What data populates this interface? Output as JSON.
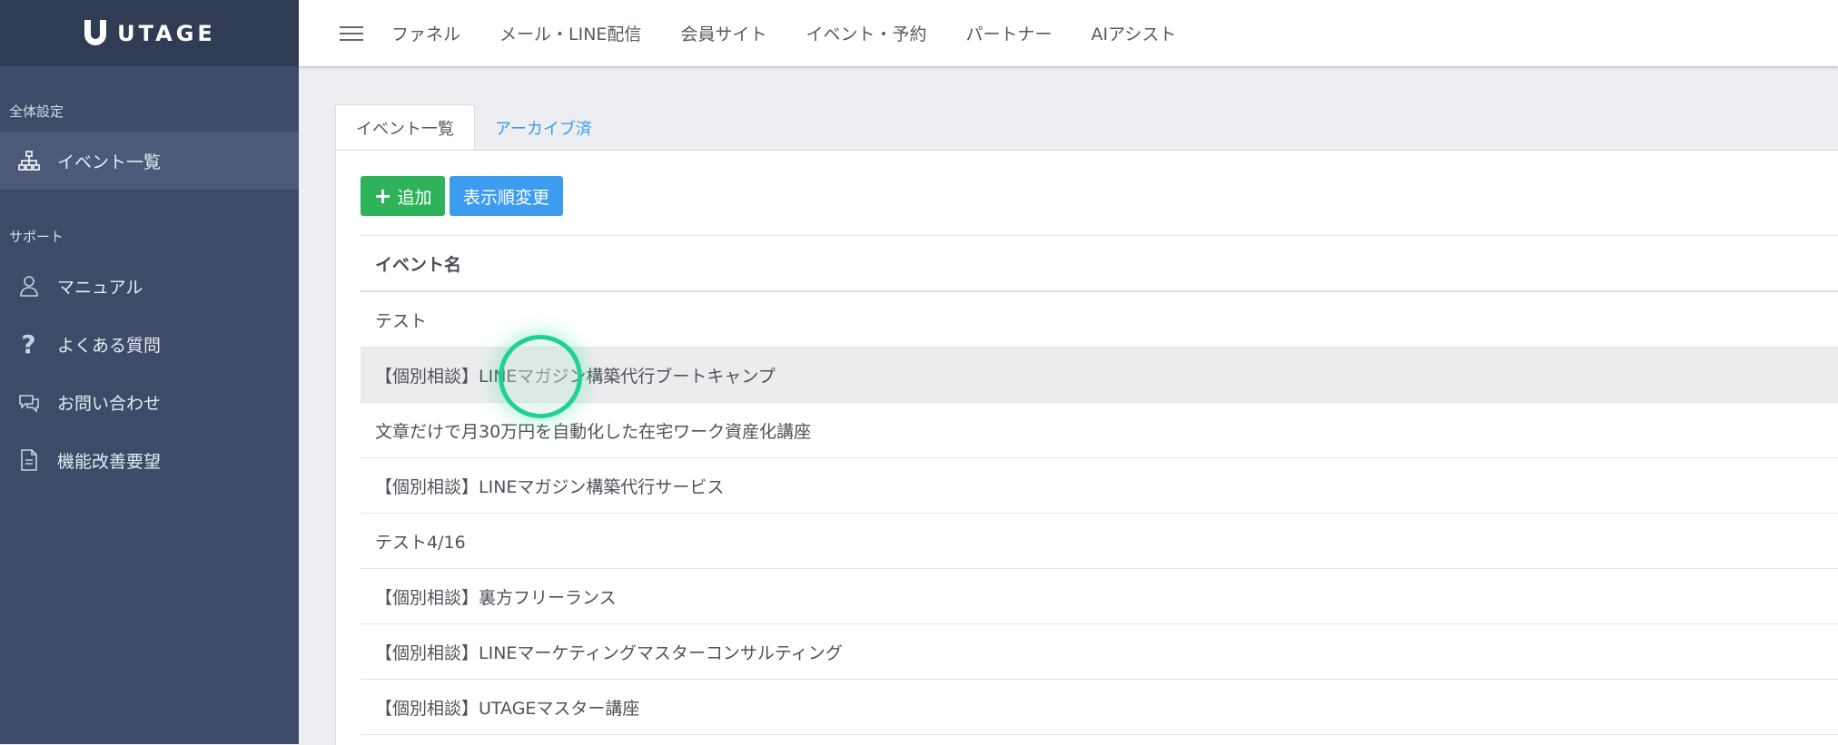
{
  "brand": {
    "name": "UTAGE"
  },
  "sidebar": {
    "section1": "全体設定",
    "active_item": {
      "label": "イベント一覧",
      "icon": "sitemap-icon"
    },
    "section2": "サポート",
    "items": [
      {
        "label": "マニュアル",
        "icon": "user-icon"
      },
      {
        "label": "よくある質問",
        "icon": "question-icon"
      },
      {
        "label": "お問い合わせ",
        "icon": "chat-icon"
      },
      {
        "label": "機能改善要望",
        "icon": "document-icon"
      }
    ]
  },
  "topnav": {
    "links": [
      "ファネル",
      "メール・LINE配信",
      "会員サイト",
      "イベント・予約",
      "パートナー",
      "AIアシスト"
    ]
  },
  "tabs": [
    "イベント一覧",
    "アーカイブ済"
  ],
  "toolbar": {
    "add_label": "追加",
    "reorder_label": "表示順変更"
  },
  "table": {
    "header": "イベント名",
    "rows": [
      "テスト",
      "【個別相談】LINEマガジン構築代行ブートキャンプ",
      "文章だけで月30万円を自動化した在宅ワーク資産化講座",
      "【個別相談】LINEマガジン構築代行サービス",
      "テスト4/16",
      "【個別相談】裏方フリーランス",
      "【個別相談】LINEマーケティングマスターコンサルティング",
      "【個別相談】UTAGEマスター講座"
    ]
  },
  "colors": {
    "sidebar": "#3c4b68",
    "brand_bar": "#2f3c53",
    "add_button": "#2fb35a",
    "reorder_button": "#3d9cf0",
    "tab_link": "#3f9be5"
  }
}
